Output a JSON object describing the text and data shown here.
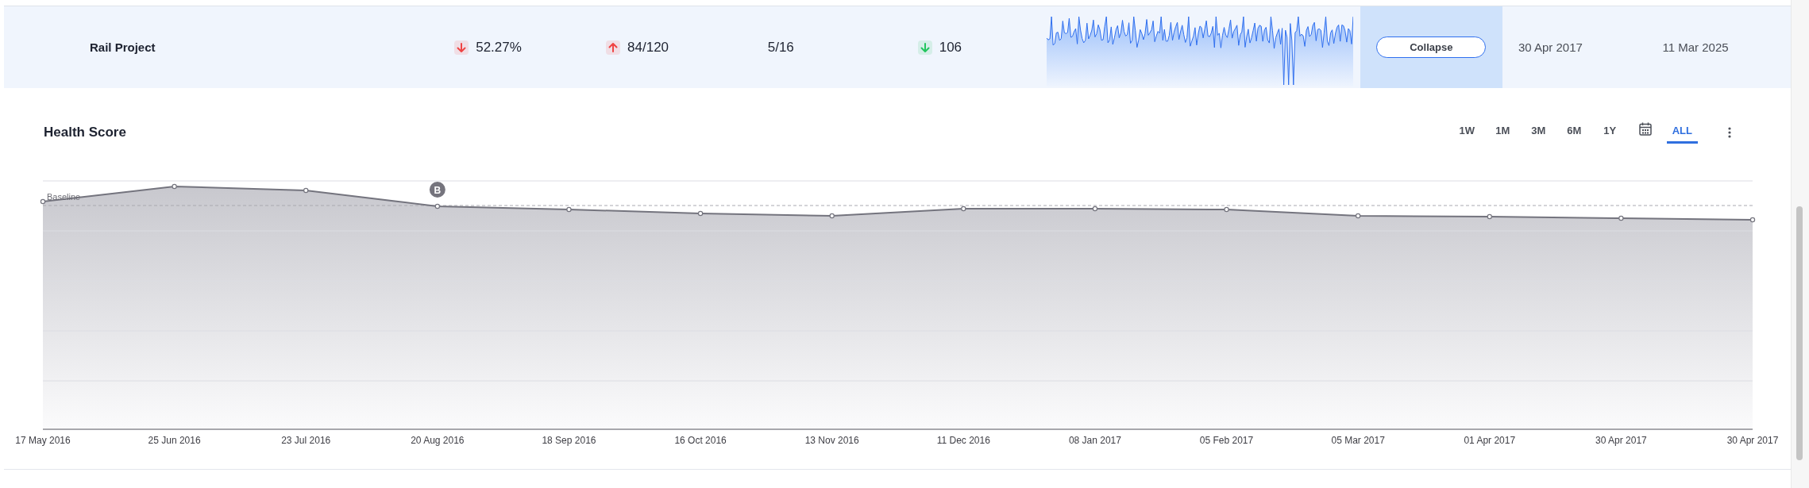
{
  "project_row": {
    "name": "Rail Project",
    "metrics": [
      {
        "value": "52.27%",
        "kind": "down",
        "color": "#ef4444"
      },
      {
        "value": "84/120",
        "kind": "up",
        "color": "#ef4444"
      },
      {
        "value": "5/16",
        "kind": "plain"
      },
      {
        "value": "106",
        "kind": "down",
        "color": "#22c55e"
      }
    ],
    "toggle_button": "Collapse",
    "start_date": "30 Apr 2017",
    "end_date": "11 Mar 2025"
  },
  "health_panel": {
    "title": "Health Score",
    "ranges": [
      {
        "label": "1W",
        "kind": "text",
        "selected": false
      },
      {
        "label": "1M",
        "kind": "text",
        "selected": false
      },
      {
        "label": "3M",
        "kind": "text",
        "selected": false
      },
      {
        "label": "6M",
        "kind": "text",
        "selected": false
      },
      {
        "label": "1Y",
        "kind": "text",
        "selected": false
      },
      {
        "kind": "calendar",
        "selected": false
      },
      {
        "label": "ALL",
        "kind": "text",
        "selected": true
      }
    ],
    "baseline_label": "Baseline",
    "marker_label": "B",
    "x_labels": [
      "17 May 2016",
      "25 Jun 2016",
      "23 Jul 2016",
      "20 Aug 2016",
      "18 Sep 2016",
      "16 Oct 2016",
      "13 Nov 2016",
      "11 Dec 2016",
      "08 Jan 2017",
      "05 Feb 2017",
      "05 Mar 2017",
      "01 Apr 2017",
      "30 Apr 2017",
      "30 Apr 2017"
    ]
  }
}
